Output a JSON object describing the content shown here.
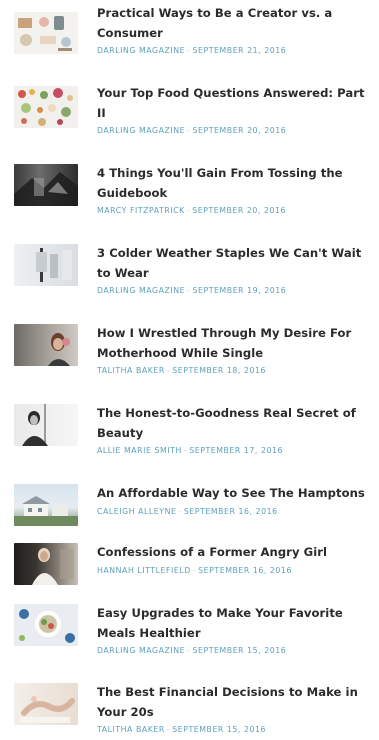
{
  "articles": [
    {
      "title": "Practical Ways to Be a Creator vs. a Consumer",
      "author": "DARLING MAGAZINE",
      "date": "SEPTEMBER 21, 2016",
      "thumb_icon": "creator-flatlay-thumbnail"
    },
    {
      "title": "Your Top Food Questions Answered: Part II",
      "author": "DARLING MAGAZINE",
      "date": "SEPTEMBER 20, 2016",
      "thumb_icon": "food-flatlay-thumbnail"
    },
    {
      "title": "4 Things You'll Gain From Tossing the Guidebook",
      "author": "MARCY FITZPATRICK",
      "date": "SEPTEMBER 20, 2016",
      "thumb_icon": "travel-bw-thumbnail"
    },
    {
      "title": "3 Colder Weather Staples We Can't Wait to Wear",
      "author": "DARLING MAGAZINE",
      "date": "SEPTEMBER 19, 2016",
      "thumb_icon": "fashion-thumbnail"
    },
    {
      "title": "How I Wrestled Through My Desire For Motherhood While Single",
      "author": "TALITHA BAKER",
      "date": "SEPTEMBER 18, 2016",
      "thumb_icon": "woman-portrait-thumbnail"
    },
    {
      "title": "The Honest-to-Goodness Real Secret of Beauty",
      "author": "ALLIE MARIE SMITH",
      "date": "SEPTEMBER 17, 2016",
      "thumb_icon": "beauty-bw-thumbnail"
    },
    {
      "title": "An Affordable Way to See The Hamptons",
      "author": "CALEIGH ALLEYNE",
      "date": "SEPTEMBER 16, 2016",
      "thumb_icon": "hamptons-house-thumbnail"
    },
    {
      "title": "Confessions of a Former Angry Girl",
      "author": "HANNAH LITTLEFIELD",
      "date": "SEPTEMBER 16, 2016",
      "thumb_icon": "woman-seated-thumbnail"
    },
    {
      "title": "Easy Upgrades to Make Your Favorite Meals Healthier",
      "author": "DARLING MAGAZINE",
      "date": "SEPTEMBER 15, 2016",
      "thumb_icon": "healthy-meal-thumbnail"
    },
    {
      "title": "The Best Financial Decisions to Make in Your 20s",
      "author": "TALITHA BAKER",
      "date": "SEPTEMBER 15, 2016",
      "thumb_icon": "finance-thumbnail"
    }
  ],
  "meta_separator": "-",
  "colors": {
    "title": "#2b2b2b",
    "meta": "#5d9fbe",
    "background": "#ffffff"
  }
}
